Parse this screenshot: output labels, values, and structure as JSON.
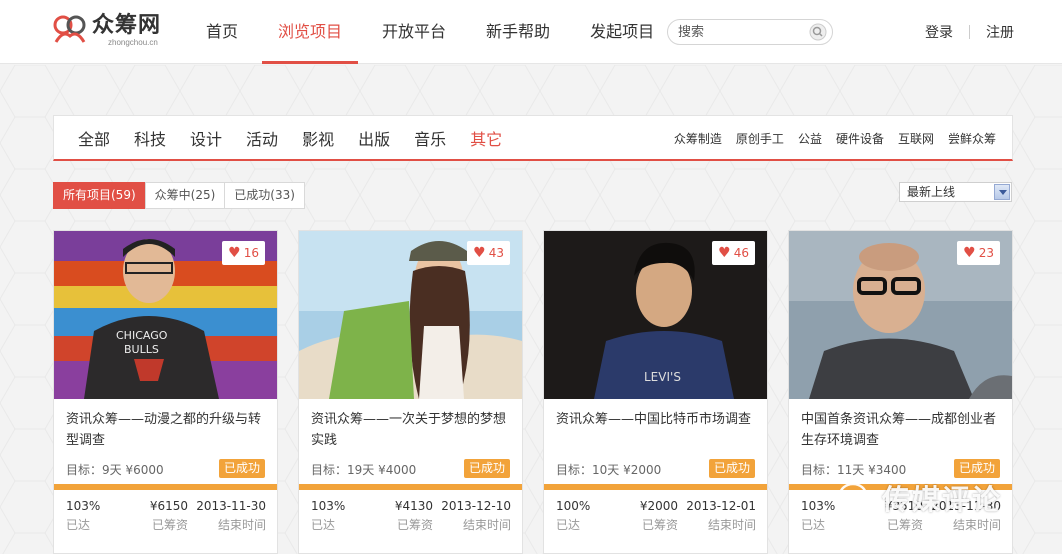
{
  "header": {
    "logo": {
      "name": "众筹网",
      "domain": "zhongchou.cn"
    },
    "nav": [
      {
        "label": "首页",
        "active": false
      },
      {
        "label": "浏览项目",
        "active": true
      },
      {
        "label": "开放平台",
        "active": false
      },
      {
        "label": "新手帮助",
        "active": false
      },
      {
        "label": "发起项目",
        "active": false
      }
    ],
    "search": {
      "placeholder": "搜索",
      "value": ""
    },
    "login": "登录",
    "register": "注册"
  },
  "categories": {
    "main": [
      {
        "label": "全部",
        "active": false
      },
      {
        "label": "科技",
        "active": false
      },
      {
        "label": "设计",
        "active": false
      },
      {
        "label": "活动",
        "active": false
      },
      {
        "label": "影视",
        "active": false
      },
      {
        "label": "出版",
        "active": false
      },
      {
        "label": "音乐",
        "active": false
      },
      {
        "label": "其它",
        "active": true
      }
    ],
    "sub": [
      "众筹制造",
      "原创手工",
      "公益",
      "硬件设备",
      "互联网",
      "尝鲜众筹"
    ]
  },
  "filters": [
    {
      "label": "所有项目(59)",
      "active": true
    },
    {
      "label": "众筹中(25)",
      "active": false
    },
    {
      "label": "已成功(33)",
      "active": false
    }
  ],
  "sort": {
    "selected": "最新上线"
  },
  "colors": {
    "accent": "#e14f45",
    "success": "#f2a33a"
  },
  "cards": [
    {
      "likes": "16",
      "title": "资讯众筹——动漫之都的升级与转型调查",
      "goal": "目标：9天 ¥6000",
      "status": "已成功",
      "percent": "103%",
      "percent_label": "已达",
      "raised": "¥6150",
      "raised_label": "已筹资",
      "end_date": "2013-11-30",
      "end_label": "结束时间"
    },
    {
      "likes": "43",
      "title": "资讯众筹——一次关于梦想的梦想实践",
      "goal": "目标：19天 ¥4000",
      "status": "已成功",
      "percent": "103%",
      "percent_label": "已达",
      "raised": "¥4130",
      "raised_label": "已筹资",
      "end_date": "2013-12-10",
      "end_label": "结束时间"
    },
    {
      "likes": "46",
      "title": "资讯众筹——中国比特币市场调查",
      "goal": "目标：10天 ¥2000",
      "status": "已成功",
      "percent": "100%",
      "percent_label": "已达",
      "raised": "¥2000",
      "raised_label": "已筹资",
      "end_date": "2013-12-01",
      "end_label": "结束时间"
    },
    {
      "likes": "23",
      "title": "中国首条资讯众筹——成都创业者生存环境调查",
      "goal": "目标：11天 ¥3400",
      "status": "已成功",
      "percent": "103%",
      "percent_label": "已达",
      "raised": "¥3510",
      "raised_label": "已筹资",
      "end_date": "2013-11-30",
      "end_label": "结束时间"
    }
  ],
  "watermark": {
    "text": "传媒评论"
  }
}
